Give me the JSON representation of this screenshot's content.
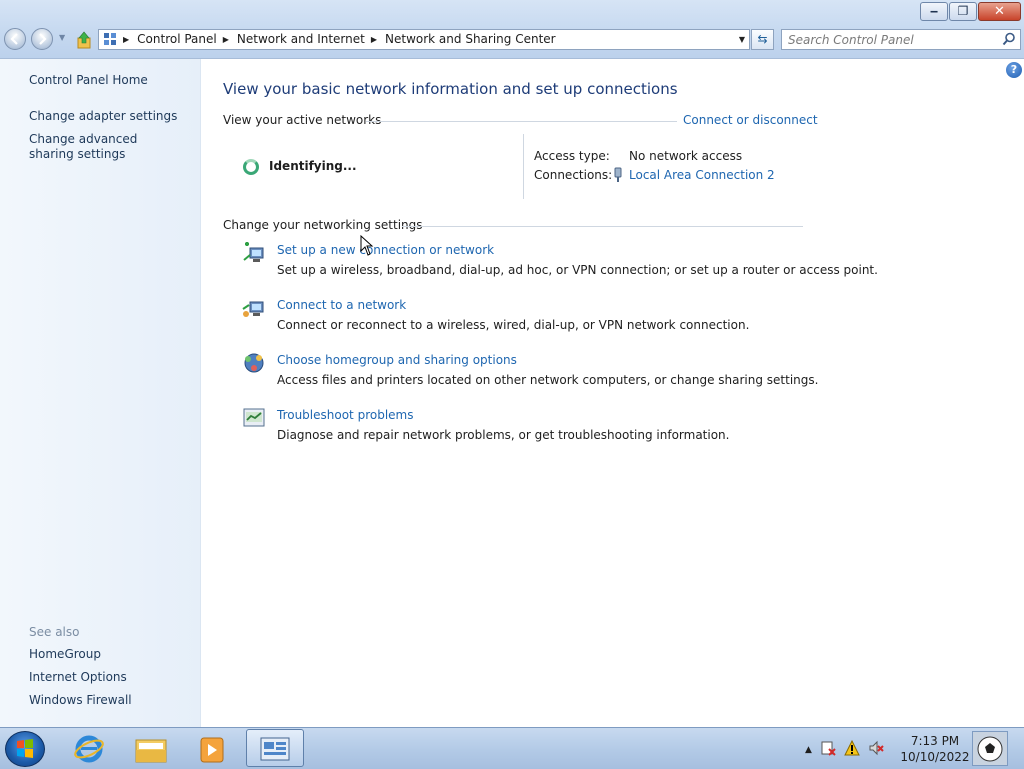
{
  "window": {
    "buttons": {
      "minimize": "‒",
      "maximize": "❐",
      "close": "✕"
    }
  },
  "address_bar": {
    "breadcrumbs": [
      "Control Panel",
      "Network and Internet",
      "Network and Sharing Center"
    ],
    "search_placeholder": "Search Control Panel"
  },
  "sidebar": {
    "home": "Control Panel Home",
    "links": [
      "Change adapter settings",
      "Change advanced sharing settings"
    ],
    "see_also_label": "See also",
    "see_also": [
      "HomeGroup",
      "Internet Options",
      "Windows Firewall"
    ]
  },
  "main": {
    "title": "View your basic network information and set up connections",
    "active_networks_header": "View your active networks",
    "connect_disconnect_link": "Connect or disconnect",
    "network_status": "Identifying...",
    "access_type_label": "Access type:",
    "access_type_value": "No network access",
    "connections_label": "Connections:",
    "connections_value": "Local Area Connection 2",
    "change_settings_header": "Change your networking settings",
    "tasks": [
      {
        "icon": "network-setup-icon",
        "link": "Set up a new connection or network",
        "desc": "Set up a wireless, broadband, dial-up, ad hoc, or VPN connection; or set up a router or access point."
      },
      {
        "icon": "connect-network-icon",
        "link": "Connect to a network",
        "desc": "Connect or reconnect to a wireless, wired, dial-up, or VPN network connection."
      },
      {
        "icon": "homegroup-icon",
        "link": "Choose homegroup and sharing options",
        "desc": "Access files and printers located on other network computers, or change sharing settings."
      },
      {
        "icon": "troubleshoot-icon",
        "link": "Troubleshoot problems",
        "desc": "Diagnose and repair network problems, or get troubleshooting information."
      }
    ]
  },
  "taskbar": {
    "time": "7:13 PM",
    "date": "10/10/2022"
  },
  "colors": {
    "link": "#1e66b0",
    "title": "#1e3c78",
    "nav_bg": "#e6eff9"
  }
}
